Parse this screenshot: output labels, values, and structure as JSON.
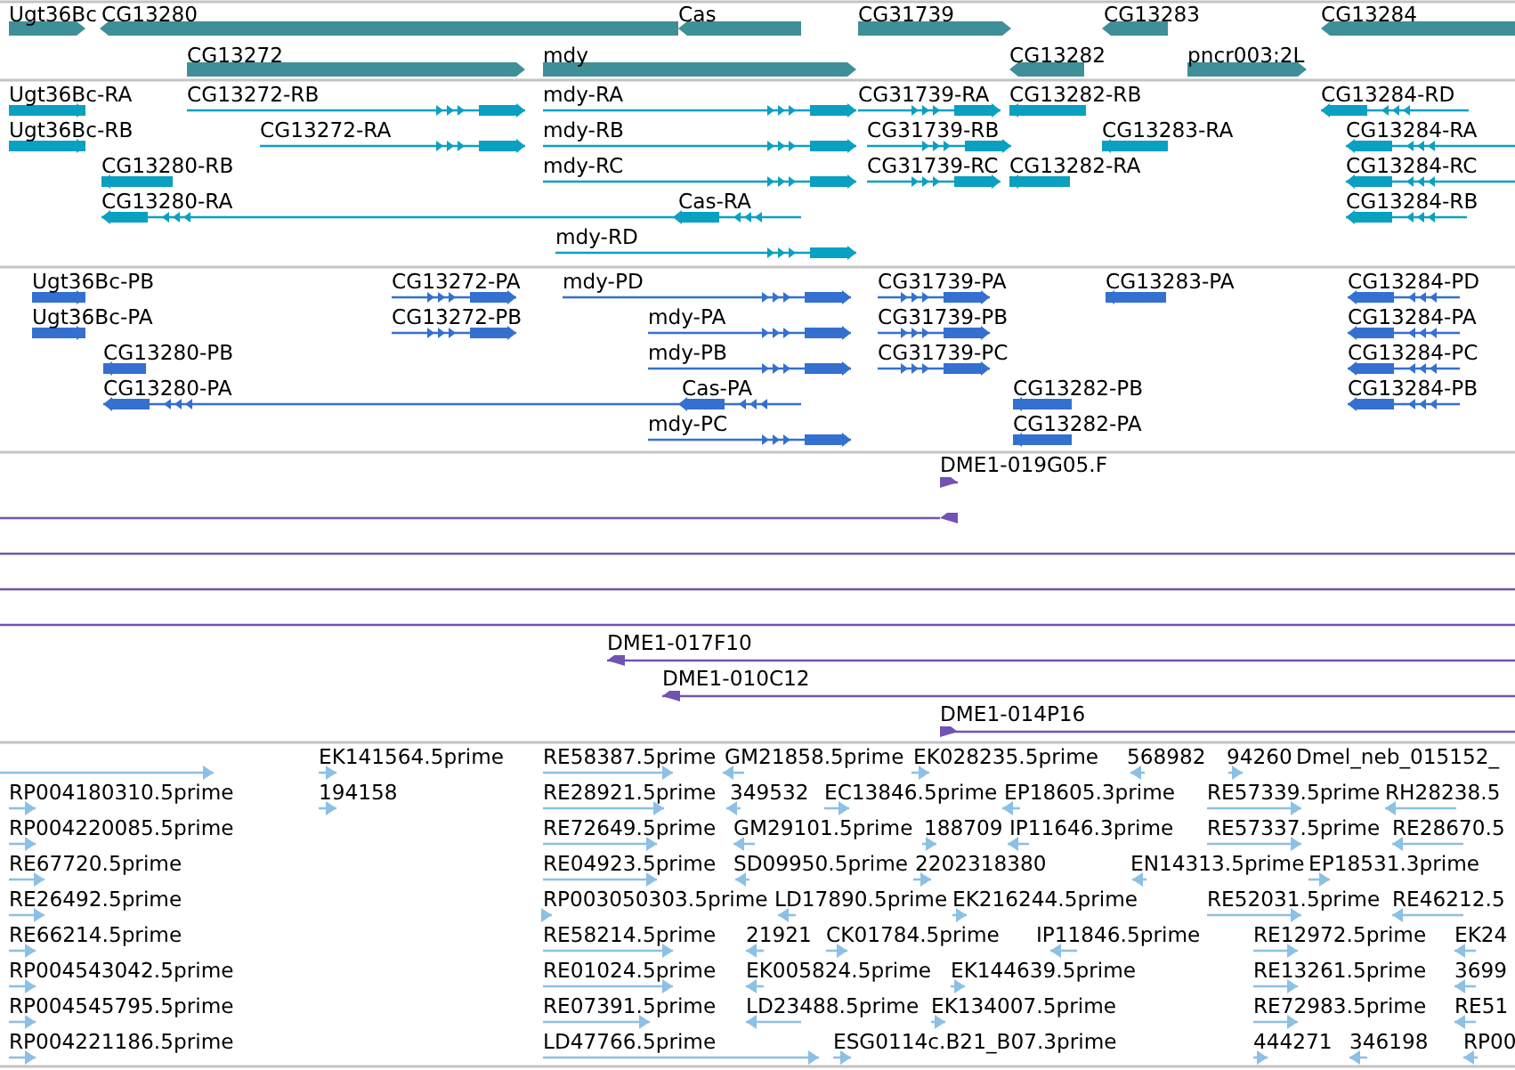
{
  "tracks": [
    {
      "kind": "gene",
      "features": [
        {
          "label": "Ugt36Bc",
          "reverse": false
        },
        {
          "label": "CG13280",
          "reverse": true
        },
        {
          "label": "Cas",
          "reverse": true
        },
        {
          "label": "CG31739",
          "reverse": false
        },
        {
          "label": "CG13283",
          "reverse": true
        },
        {
          "label": "CG13284",
          "reverse": true
        },
        {
          "label": "CG13272",
          "reverse": false
        },
        {
          "label": "mdy",
          "reverse": false
        },
        {
          "label": "CG13282",
          "reverse": true
        },
        {
          "label": "pncr003:2L",
          "reverse": false
        }
      ]
    },
    {
      "kind": "transcript",
      "features": [
        {
          "label": "Ugt36Bc-RA",
          "reverse": false
        },
        {
          "label": "CG13272-RB",
          "reverse": false
        },
        {
          "label": "mdy-RA",
          "reverse": false
        },
        {
          "label": "CG31739-RA",
          "reverse": false
        },
        {
          "label": "CG13282-RB",
          "reverse": true
        },
        {
          "label": "CG13284-RD",
          "reverse": true
        },
        {
          "label": "Ugt36Bc-RB",
          "reverse": false
        },
        {
          "label": "CG13272-RA",
          "reverse": false
        },
        {
          "label": "mdy-RB",
          "reverse": false
        },
        {
          "label": "CG31739-RB",
          "reverse": false
        },
        {
          "label": "CG13283-RA",
          "reverse": true
        },
        {
          "label": "CG13284-RA",
          "reverse": true
        },
        {
          "label": "CG13280-RB",
          "reverse": true
        },
        {
          "label": "mdy-RC",
          "reverse": false
        },
        {
          "label": "CG31739-RC",
          "reverse": false
        },
        {
          "label": "CG13282-RA",
          "reverse": true
        },
        {
          "label": "CG13284-RC",
          "reverse": true
        },
        {
          "label": "CG13280-RA",
          "reverse": true
        },
        {
          "label": "Cas-RA",
          "reverse": true
        },
        {
          "label": "CG13284-RB",
          "reverse": true
        },
        {
          "label": "mdy-RD",
          "reverse": false
        }
      ]
    },
    {
      "kind": "protein",
      "features": [
        {
          "label": "Ugt36Bc-PB",
          "reverse": false
        },
        {
          "label": "CG13272-PA",
          "reverse": false
        },
        {
          "label": "mdy-PD",
          "reverse": false
        },
        {
          "label": "CG31739-PA",
          "reverse": false
        },
        {
          "label": "CG13283-PA",
          "reverse": true
        },
        {
          "label": "CG13284-PD",
          "reverse": true
        },
        {
          "label": "Ugt36Bc-PA",
          "reverse": false
        },
        {
          "label": "CG13272-PB",
          "reverse": false
        },
        {
          "label": "mdy-PA",
          "reverse": false
        },
        {
          "label": "CG31739-PB",
          "reverse": false
        },
        {
          "label": "CG13284-PA",
          "reverse": true
        },
        {
          "label": "CG13280-PB",
          "reverse": true
        },
        {
          "label": "mdy-PB",
          "reverse": false
        },
        {
          "label": "CG31739-PC",
          "reverse": false
        },
        {
          "label": "CG13284-PC",
          "reverse": true
        },
        {
          "label": "CG13280-PA",
          "reverse": true
        },
        {
          "label": "Cas-PA",
          "reverse": true
        },
        {
          "label": "CG13282-PB",
          "reverse": true
        },
        {
          "label": "CG13284-PB",
          "reverse": true
        },
        {
          "label": "mdy-PC",
          "reverse": false
        },
        {
          "label": "CG13282-PA",
          "reverse": true
        }
      ]
    },
    {
      "kind": "clone",
      "features": [
        {
          "kind": "end",
          "label": "DME1-019G05.F",
          "reverse": false
        },
        {
          "kind": "end",
          "reverse": true
        },
        {
          "kind": "span"
        },
        {
          "kind": "span"
        },
        {
          "kind": "span"
        },
        {
          "kind": "end",
          "label": "DME1-017F10",
          "reverse": true
        },
        {
          "kind": "end",
          "label": "DME1-010C12",
          "reverse": true
        },
        {
          "kind": "end",
          "label": "DME1-014P16",
          "reverse": false
        }
      ]
    },
    {
      "kind": "est",
      "features": [
        {
          "reverse": false
        },
        {
          "label": "EK141564.5prime",
          "reverse": false
        },
        {
          "label": "RE58387.5prime",
          "reverse": false
        },
        {
          "label": "GM21858.5prime",
          "reverse": true
        },
        {
          "label": "EK028235.5prime",
          "reverse": false
        },
        {
          "label": "568982",
          "reverse": true
        },
        {
          "label": "94260",
          "reverse": false
        },
        {
          "label": "Dmel_neb_015152_"
        },
        {
          "label": "RP004180310.5prime",
          "reverse": false
        },
        {
          "label": "194158",
          "reverse": false
        },
        {
          "label": "RE28921.5prime",
          "reverse": false
        },
        {
          "label": "349532",
          "reverse": true
        },
        {
          "label": "EC13846.5prime",
          "reverse": false
        },
        {
          "label": "EP18605.3prime",
          "reverse": true
        },
        {
          "label": "RE57339.5prime",
          "reverse": false
        },
        {
          "label": "RH28238.5",
          "reverse": true
        },
        {
          "label": "RP004220085.5prime",
          "reverse": false
        },
        {
          "label": "RE72649.5prime",
          "reverse": false
        },
        {
          "label": "GM29101.5prime",
          "reverse": true
        },
        {
          "label": "188709",
          "reverse": false
        },
        {
          "label": "IP11646.3prime",
          "reverse": true
        },
        {
          "label": "RE57337.5prime",
          "reverse": false
        },
        {
          "label": "RE28670.5",
          "reverse": true
        },
        {
          "label": "RE67720.5prime",
          "reverse": false
        },
        {
          "label": "RE04923.5prime",
          "reverse": false
        },
        {
          "label": "SD09950.5prime",
          "reverse": true
        },
        {
          "label": "2202318380",
          "reverse": false
        },
        {
          "label": "EN14313.5prime",
          "reverse": true
        },
        {
          "label": "EP18531.3prime",
          "reverse": false
        },
        {
          "label": "RE26492.5prime",
          "reverse": false
        },
        {
          "label": "RP003050303.5prime",
          "reverse": false
        },
        {
          "label": "LD17890.5prime",
          "reverse": true
        },
        {
          "label": "EK216244.5prime",
          "reverse": false
        },
        {
          "label": "RE52031.5prime",
          "reverse": false
        },
        {
          "label": "RE46212.5",
          "reverse": true
        },
        {
          "label": "RE66214.5prime",
          "reverse": false
        },
        {
          "label": "RE58214.5prime",
          "reverse": false
        },
        {
          "label": "21921",
          "reverse": true
        },
        {
          "label": "CK01784.5prime",
          "reverse": false
        },
        {
          "label": "IP11846.5prime",
          "reverse": true
        },
        {
          "label": "RE12972.5prime",
          "reverse": false
        },
        {
          "label": "EK24",
          "reverse": true
        },
        {
          "label": "RP004543042.5prime",
          "reverse": false
        },
        {
          "label": "RE01024.5prime",
          "reverse": false
        },
        {
          "label": "EK005824.5prime",
          "reverse": true
        },
        {
          "label": "EK144639.5prime",
          "reverse": false
        },
        {
          "label": "RE13261.5prime",
          "reverse": false
        },
        {
          "label": "3699",
          "reverse": true
        },
        {
          "label": "RP004545795.5prime",
          "reverse": false
        },
        {
          "label": "RE07391.5prime",
          "reverse": false
        },
        {
          "label": "LD23488.5prime",
          "reverse": true
        },
        {
          "label": "EK134007.5prime",
          "reverse": false
        },
        {
          "label": "RE72983.5prime",
          "reverse": false
        },
        {
          "label": "RE51",
          "reverse": true
        },
        {
          "label": "RP004221186.5prime",
          "reverse": false
        },
        {
          "label": "LD47766.5prime",
          "reverse": false
        },
        {
          "label": "ESG0114c.B21_B07.3prime",
          "reverse": false
        },
        {
          "label": "444271",
          "reverse": false
        },
        {
          "label": "346198",
          "reverse": true
        },
        {
          "label": "RP00",
          "reverse": true
        }
      ]
    }
  ]
}
